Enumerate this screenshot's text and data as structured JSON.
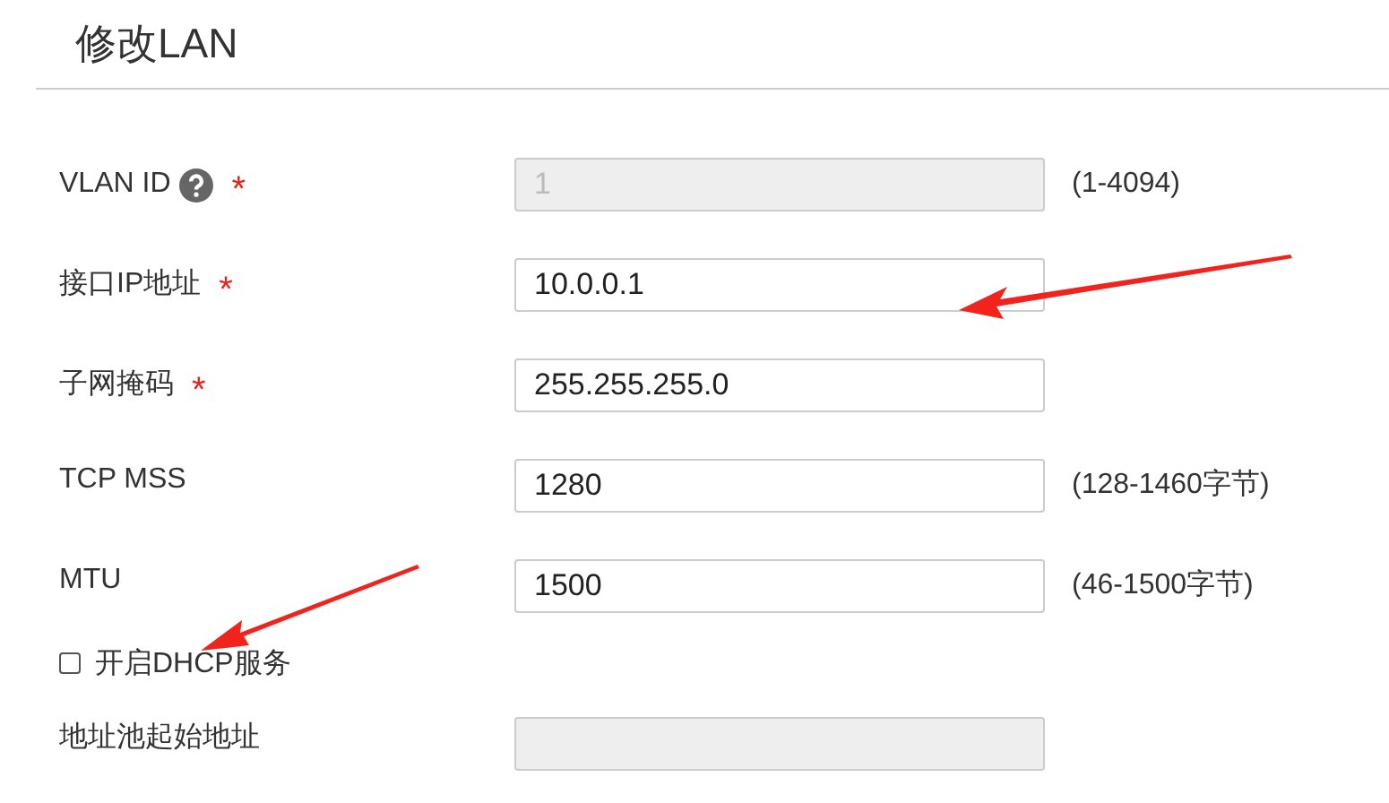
{
  "title": "修改LAN",
  "fields": [
    {
      "kind": "input",
      "label": "VLAN ID",
      "help": true,
      "required_mark": "*",
      "value": "1",
      "disabled": true,
      "hint": "(1-4094)"
    },
    {
      "kind": "input",
      "label": "接口IP地址",
      "help": false,
      "required_mark": "*",
      "value": "10.0.0.1",
      "disabled": false
    },
    {
      "kind": "input",
      "label": "子网掩码",
      "help": false,
      "required_mark": "*",
      "value": "255.255.255.0",
      "disabled": false
    },
    {
      "kind": "input",
      "label": "TCP MSS",
      "help": false,
      "value": "1280",
      "disabled": false,
      "hint": "(128-1460字节)"
    },
    {
      "kind": "input",
      "label": "MTU",
      "help": false,
      "value": "1500",
      "disabled": false,
      "hint": "(46-1500字节)"
    },
    {
      "kind": "checkbox",
      "label": "开启DHCP服务",
      "checked": false
    },
    {
      "kind": "input",
      "label": "地址池起始地址",
      "help": false,
      "disabled": true
    }
  ]
}
